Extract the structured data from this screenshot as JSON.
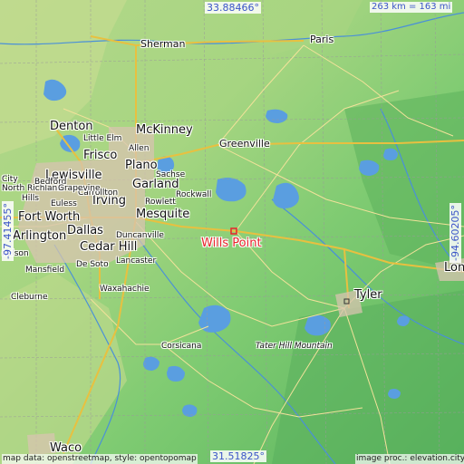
{
  "map": {
    "marker": {
      "label": "Wills Point",
      "color": "#e8242a"
    },
    "coords": {
      "top": "33.88466°",
      "bottom": "31.51825°",
      "left": "-97.41455°",
      "right": "-94.60205°"
    },
    "scale": "263 km = 163 mi",
    "attribution_left": "map data: openstreetmap, style: opentopomap",
    "attribution_right": "image proc.: elevation.city",
    "cities_large": [
      "Denton",
      "McKinney",
      "Frisco",
      "Plano",
      "Lewisville",
      "Garland",
      "Irving",
      "Mesquite",
      "Fort Worth",
      "Dallas",
      "Cedar Hill",
      "Tyler",
      "Waco",
      "Arlington",
      "Lon"
    ],
    "cities_medium": [
      "Sherman",
      "Paris",
      "Greenville",
      "Rockwall",
      "Sachse",
      "Rowlett",
      "Carrollton",
      "Duncanville",
      "Lancaster",
      "De Soto",
      "Mansfield",
      "Waxahachie",
      "Cleburne",
      "Corsicana",
      "Little Elm",
      "Allen",
      "North Richland",
      "Hills",
      "City",
      "Bedford",
      "Euless",
      "Grapevine",
      "nelson"
    ],
    "feature": "Tater Hill Mountain",
    "colors": {
      "land_low": "#8ccc78",
      "land_mid": "#b9d98a",
      "water": "#5a9ee0",
      "road_primary": "#e8c040",
      "road_secondary": "#f2e29a",
      "border": "#9a9a9a",
      "coord_text": "#3a54c8"
    }
  }
}
